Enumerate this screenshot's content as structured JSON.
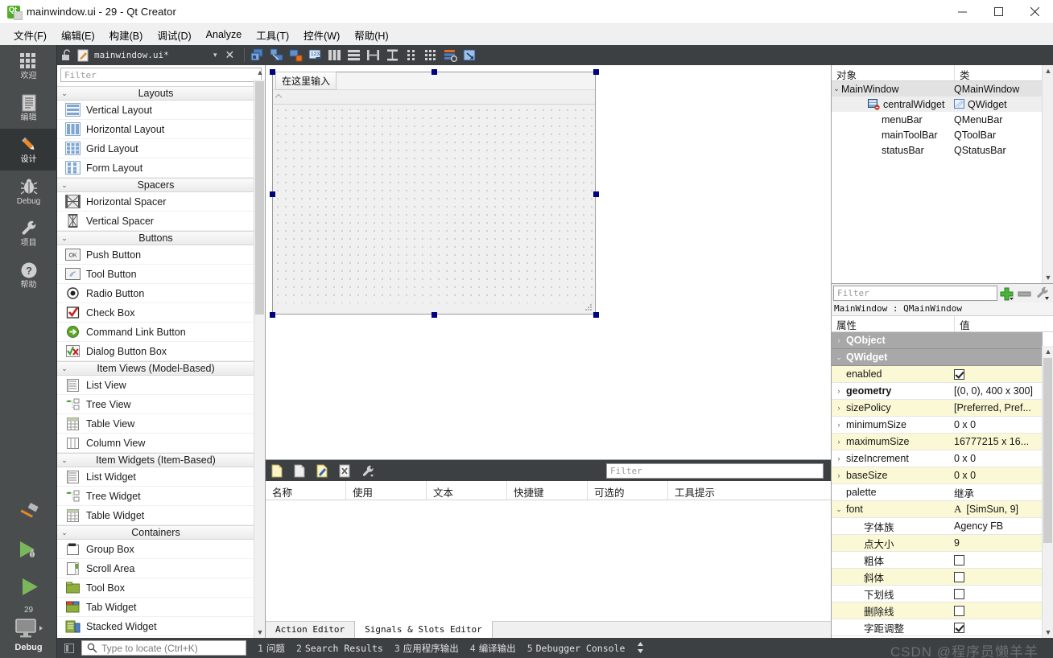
{
  "window": {
    "title": "mainwindow.ui - 29 - Qt Creator",
    "app_icon": "qt-logo-icon",
    "minimize": "—",
    "maximize": "□",
    "close": "✕"
  },
  "menubar": {
    "items": [
      {
        "label": "文件(F)"
      },
      {
        "label": "编辑(E)"
      },
      {
        "label": "构建(B)"
      },
      {
        "label": "调试(D)"
      },
      {
        "label": "Analyze"
      },
      {
        "label": "工具(T)"
      },
      {
        "label": "控件(W)"
      },
      {
        "label": "帮助(H)"
      }
    ]
  },
  "modebar": {
    "items": [
      {
        "label": "欢迎",
        "icon": "grid-icon",
        "active": false
      },
      {
        "label": "编辑",
        "icon": "document-lines-icon",
        "active": false
      },
      {
        "label": "设计",
        "icon": "pencil-icon",
        "active": true
      },
      {
        "label": "Debug",
        "icon": "bug-icon",
        "active": false
      },
      {
        "label": "项目",
        "icon": "wrench-icon",
        "active": false
      },
      {
        "label": "帮助",
        "icon": "question-circle-icon",
        "active": false
      }
    ],
    "kit_number": "29",
    "target_label": "Debug",
    "target_icon": "monitor-icon",
    "run_icon": "run-play-icon",
    "debug_icon": "debug-play-icon",
    "build_icon": "hammer-icon"
  },
  "editor_toolbar": {
    "lock_icon": "unlocked-icon",
    "file_icon": "ui-file-icon",
    "filename": "mainwindow.ui*",
    "dropdown_icon": "chevron-down-icon",
    "close_icon": "close-x-icon",
    "buttons": [
      {
        "name": "edit-widgets-icon"
      },
      {
        "name": "edit-signals-slots-icon"
      },
      {
        "name": "edit-buddies-icon"
      },
      {
        "name": "edit-tab-order-icon"
      },
      {
        "name": "layout-horizontally-icon"
      },
      {
        "name": "layout-vertically-icon"
      },
      {
        "name": "layout-horizontal-splitter-icon"
      },
      {
        "name": "layout-vertical-splitter-icon"
      },
      {
        "name": "layout-form-icon"
      },
      {
        "name": "layout-grid-icon"
      },
      {
        "name": "break-layout-icon"
      },
      {
        "name": "adjust-size-icon"
      }
    ]
  },
  "widget_box": {
    "filter_placeholder": "Filter",
    "groups": [
      {
        "title": "Layouts",
        "items": [
          {
            "label": "Vertical Layout",
            "icon": "vertical-layout-icon"
          },
          {
            "label": "Horizontal Layout",
            "icon": "horizontal-layout-icon"
          },
          {
            "label": "Grid Layout",
            "icon": "grid-layout-icon"
          },
          {
            "label": "Form Layout",
            "icon": "form-layout-icon"
          }
        ]
      },
      {
        "title": "Spacers",
        "items": [
          {
            "label": "Horizontal Spacer",
            "icon": "horizontal-spacer-icon"
          },
          {
            "label": "Vertical Spacer",
            "icon": "vertical-spacer-icon"
          }
        ]
      },
      {
        "title": "Buttons",
        "items": [
          {
            "label": "Push Button",
            "icon": "push-button-icon"
          },
          {
            "label": "Tool Button",
            "icon": "tool-button-icon"
          },
          {
            "label": "Radio Button",
            "icon": "radio-button-icon"
          },
          {
            "label": "Check Box",
            "icon": "check-box-icon"
          },
          {
            "label": "Command Link Button",
            "icon": "command-link-icon"
          },
          {
            "label": "Dialog Button Box",
            "icon": "dialog-button-box-icon"
          }
        ]
      },
      {
        "title": "Item Views (Model-Based)",
        "items": [
          {
            "label": "List View",
            "icon": "list-view-icon"
          },
          {
            "label": "Tree View",
            "icon": "tree-view-icon"
          },
          {
            "label": "Table View",
            "icon": "table-view-icon"
          },
          {
            "label": "Column View",
            "icon": "column-view-icon"
          }
        ]
      },
      {
        "title": "Item Widgets (Item-Based)",
        "items": [
          {
            "label": "List Widget",
            "icon": "list-widget-icon"
          },
          {
            "label": "Tree Widget",
            "icon": "tree-widget-icon"
          },
          {
            "label": "Table Widget",
            "icon": "table-widget-icon"
          }
        ]
      },
      {
        "title": "Containers",
        "items": [
          {
            "label": "Group Box",
            "icon": "group-box-icon"
          },
          {
            "label": "Scroll Area",
            "icon": "scroll-area-icon"
          },
          {
            "label": "Tool Box",
            "icon": "tool-box-icon"
          },
          {
            "label": "Tab Widget",
            "icon": "tab-widget-icon"
          },
          {
            "label": "Stacked Widget",
            "icon": "stacked-widget-icon"
          }
        ]
      }
    ]
  },
  "canvas": {
    "form_menu_placeholder": "在这里输入",
    "selected": true
  },
  "object_inspector": {
    "headers": {
      "object": "对象",
      "class": "类"
    },
    "rows": [
      {
        "name": "MainWindow",
        "class": "QMainWindow",
        "indent": 0,
        "expander": "▾",
        "icon": "",
        "selected": true
      },
      {
        "name": "centralWidget",
        "class": "QWidget",
        "indent": 1,
        "expander": "",
        "icon": "central-widget-icon",
        "selected": false
      },
      {
        "name": "menuBar",
        "class": "QMenuBar",
        "indent": 1,
        "expander": "",
        "icon": "",
        "selected": false
      },
      {
        "name": "mainToolBar",
        "class": "QToolBar",
        "indent": 1,
        "expander": "",
        "icon": "",
        "selected": false
      },
      {
        "name": "statusBar",
        "class": "QStatusBar",
        "indent": 1,
        "expander": "",
        "icon": "",
        "selected": false
      }
    ]
  },
  "property_editor": {
    "filter_placeholder": "Filter",
    "add_icon": "plus-icon",
    "remove_icon": "minus-icon",
    "config_icon": "wrench-icon",
    "object_line": "MainWindow : QMainWindow",
    "headers": {
      "property": "属性",
      "value": "值"
    },
    "rows": [
      {
        "label": "QObject",
        "value": "",
        "type": "group",
        "expander": "›",
        "bold": true
      },
      {
        "label": "QWidget",
        "value": "",
        "type": "group",
        "expander": "⌄",
        "bold": true
      },
      {
        "label": "enabled",
        "value": "",
        "type": "checkbox",
        "checked": true,
        "expander": "",
        "bold": false,
        "shade": "yellow"
      },
      {
        "label": "geometry",
        "value": "[(0, 0), 400 x 300]",
        "type": "text",
        "expander": "›",
        "bold": true,
        "shade": "white"
      },
      {
        "label": "sizePolicy",
        "value": "[Preferred, Pref...",
        "type": "text",
        "expander": "›",
        "bold": false,
        "shade": "yellow"
      },
      {
        "label": "minimumSize",
        "value": "0 x 0",
        "type": "text",
        "expander": "›",
        "bold": false,
        "shade": "white"
      },
      {
        "label": "maximumSize",
        "value": "16777215 x 16...",
        "type": "text",
        "expander": "›",
        "bold": false,
        "shade": "yellow"
      },
      {
        "label": "sizeIncrement",
        "value": "0 x 0",
        "type": "text",
        "expander": "›",
        "bold": false,
        "shade": "white"
      },
      {
        "label": "baseSize",
        "value": "0 x 0",
        "type": "text",
        "expander": "›",
        "bold": false,
        "shade": "yellow"
      },
      {
        "label": "palette",
        "value": "继承",
        "type": "text",
        "expander": "",
        "bold": false,
        "shade": "white"
      },
      {
        "label": "font",
        "value": "[SimSun, 9]",
        "type": "font",
        "expander": "⌄",
        "bold": false,
        "shade": "yellow"
      },
      {
        "label": "字体族",
        "value": "Agency FB",
        "type": "text",
        "expander": "",
        "bold": false,
        "shade": "white",
        "indent": true
      },
      {
        "label": "点大小",
        "value": "9",
        "type": "text",
        "expander": "",
        "bold": false,
        "shade": "yellow",
        "indent": true
      },
      {
        "label": "粗体",
        "value": "",
        "type": "checkbox",
        "checked": false,
        "expander": "",
        "bold": false,
        "shade": "white",
        "indent": true
      },
      {
        "label": "斜体",
        "value": "",
        "type": "checkbox",
        "checked": false,
        "expander": "",
        "bold": false,
        "shade": "yellow",
        "indent": true
      },
      {
        "label": "下划线",
        "value": "",
        "type": "checkbox",
        "checked": false,
        "expander": "",
        "bold": false,
        "shade": "white",
        "indent": true
      },
      {
        "label": "删除线",
        "value": "",
        "type": "checkbox",
        "checked": false,
        "expander": "",
        "bold": false,
        "shade": "yellow",
        "indent": true
      },
      {
        "label": "字距调整",
        "value": "",
        "type": "checkbox",
        "checked": true,
        "expander": "",
        "bold": false,
        "shade": "white",
        "indent": true
      }
    ]
  },
  "action_editor": {
    "toolbar_icons": [
      {
        "name": "new-action-icon"
      },
      {
        "name": "copy-action-icon"
      },
      {
        "name": "edit-action-icon"
      },
      {
        "name": "delete-action-icon"
      },
      {
        "name": "action-settings-icon"
      }
    ],
    "filter_placeholder": "Filter",
    "headers": [
      "名称",
      "使用",
      "文本",
      "快捷键",
      "可选的",
      "工具提示"
    ],
    "rows": [],
    "tabs": [
      {
        "label": "Action Editor",
        "active": false
      },
      {
        "label": "Signals & Slots Editor",
        "active": true
      }
    ]
  },
  "statusbar": {
    "locate_placeholder": "Type to locate (Ctrl+K)",
    "search_icon": "search-icon",
    "outputs": [
      {
        "num": "1",
        "label": "问题"
      },
      {
        "num": "2",
        "label": "Search Results"
      },
      {
        "num": "3",
        "label": "应用程序输出"
      },
      {
        "num": "4",
        "label": "编译输出"
      },
      {
        "num": "5",
        "label": "Debugger Console"
      }
    ],
    "toggle_icon": "updown-arrows-icon"
  },
  "watermark": {
    "text": "CSDN @程序员懒羊羊"
  }
}
